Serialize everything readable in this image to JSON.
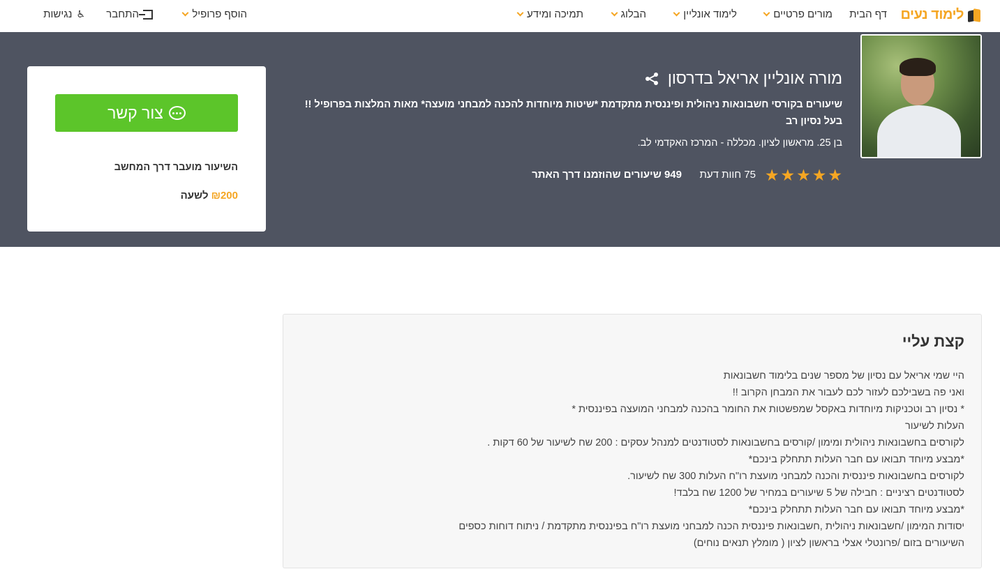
{
  "nav": {
    "logo_text": "לימוד נעים",
    "home": "דף הבית",
    "private_teachers": "מורים פרטיים",
    "online_learning": "לימוד אונליין",
    "blog": "הבלוג",
    "support": "תמיכה ומידע",
    "add_profile": "הוסף פרופיל",
    "login": "התחבר",
    "accessibility": "נגישות"
  },
  "teacher": {
    "name": "מורה אונליין אריאל בדרסון",
    "headline": "שיעורים בקורסי חשבונאות ניהולית ופיננסית מתקדמת *שיטות מיוחדות להכנה למבחני מועצה* מאות המלצות בפרופיל !! בעל נסיון רב",
    "info": "בן 25. מראשון לציון. מכללה - המרכז האקדמי לב.",
    "rating": 5,
    "reviews": "75 חוות דעת",
    "lessons_num": "949",
    "lessons_text": "שיעורים שהוזמנו דרך האתר"
  },
  "contact": {
    "button_label": "צור קשר",
    "lesson_mode": "השיעור מועבר דרך המחשב",
    "price_amount": "₪200",
    "price_unit": "לשעה"
  },
  "about": {
    "title": "קצת עליי",
    "lines": [
      "היי שמי אריאל עם נסיון של מספר שנים בלימוד חשבונאות",
      "ואני פה בשבילכם לעזור לכם לעבור את המבחן הקרוב !!",
      "* נסיון רב וטכניקות מיוחדות באקסל שמפשטות את החומר בהכנה למבחני המועצה בפיננסית *",
      "העלות לשיעור",
      "לקורסים בחשבונאות ניהולית ומימון /קורסים בחשבונאות לסטודנטים למנהל עסקים : 200 שח לשיעור של 60 דקות .",
      "*מבצע מיוחד תבואו עם חבר העלות תתחלק בינכם*",
      "לקורסים בחשבונאות פיננסית והכנה למבחני מועצת רו\"ח העלות 300 שח לשיעור.",
      "לסטודנטים רציניים : חבילה של 5 שיעורים במחיר של 1200 שח בלבד!",
      "*מבצע מיוחד תבואו עם חבר העלות תתחלק בינכם*",
      "יסודות המימון /חשבונאות ניהולית ,חשבונאות פיננסית הכנה למבחני מועצת רו\"ח בפיננסית מתקדמת / ניתוח דוחות כספים",
      "השיעורים בזום /פרונטלי אצלי בראשון לציון ( מומלץ תנאים נוחים)"
    ]
  }
}
